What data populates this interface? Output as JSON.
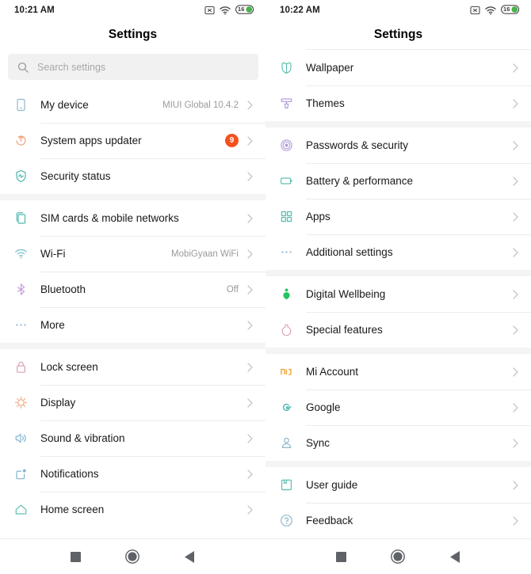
{
  "left": {
    "statusbar": {
      "clock": "10:21 AM",
      "battery_level": "16",
      "icons": [
        "no-sim-icon",
        "wifi-icon",
        "battery-icon"
      ]
    },
    "title": "Settings",
    "search": {
      "placeholder": "Search settings",
      "icon": "search-icon"
    },
    "groups": [
      {
        "rows": [
          {
            "icon": "phone-icon",
            "label": "My device",
            "value": "MIUI Global 10.4.2"
          },
          {
            "icon": "update-icon",
            "label": "System apps updater",
            "badge": "9"
          },
          {
            "icon": "shield-icon",
            "label": "Security status"
          }
        ]
      },
      {
        "rows": [
          {
            "icon": "sim-card-icon",
            "label": "SIM cards & mobile networks"
          },
          {
            "icon": "wifi-icon",
            "label": "Wi-Fi",
            "value": "MobiGyaan WiFi"
          },
          {
            "icon": "bluetooth-icon",
            "label": "Bluetooth",
            "value": "Off"
          },
          {
            "icon": "dots-icon",
            "label": "More"
          }
        ]
      },
      {
        "rows": [
          {
            "icon": "lock-icon",
            "label": "Lock screen"
          },
          {
            "icon": "brightness-icon",
            "label": "Display"
          },
          {
            "icon": "speaker-icon",
            "label": "Sound & vibration"
          },
          {
            "icon": "notification-icon",
            "label": "Notifications"
          },
          {
            "icon": "home-icon",
            "label": "Home screen"
          }
        ]
      }
    ]
  },
  "right": {
    "statusbar": {
      "clock": "10:22 AM",
      "battery_level": "16",
      "icons": [
        "no-sim-icon",
        "wifi-icon",
        "battery-icon"
      ]
    },
    "title": "Settings",
    "groups": [
      {
        "rows": [
          {
            "icon": "wallpaper-icon",
            "label": "Wallpaper"
          },
          {
            "icon": "themes-icon",
            "label": "Themes"
          }
        ]
      },
      {
        "rows": [
          {
            "icon": "fingerprint-icon",
            "label": "Passwords & security"
          },
          {
            "icon": "battery-icon",
            "label": "Battery & performance"
          },
          {
            "icon": "apps-grid-icon",
            "label": "Apps"
          },
          {
            "icon": "dots-icon",
            "label": "Additional settings"
          }
        ]
      },
      {
        "rows": [
          {
            "icon": "wellbeing-icon",
            "label": "Digital Wellbeing"
          },
          {
            "icon": "flask-icon",
            "label": "Special features"
          }
        ]
      },
      {
        "rows": [
          {
            "icon": "mi-icon",
            "label": "Mi Account"
          },
          {
            "icon": "google-icon",
            "label": "Google"
          },
          {
            "icon": "person-icon",
            "label": "Sync"
          }
        ]
      },
      {
        "rows": [
          {
            "icon": "book-icon",
            "label": "User guide"
          },
          {
            "icon": "question-icon",
            "label": "Feedback"
          }
        ]
      }
    ]
  },
  "navbar": {
    "buttons": [
      {
        "icon": "recents-square-icon",
        "label": "Recents"
      },
      {
        "icon": "home-circle-icon",
        "label": "Home"
      },
      {
        "icon": "back-triangle-icon",
        "label": "Back"
      }
    ]
  },
  "colors": {
    "badge": "#f4511e",
    "teal": "#4db6ac",
    "orange": "#f0a07a",
    "purple": "#b39ddb",
    "blue": "#8fb8cc",
    "pink": "#e0a6b8",
    "green": "#22c55e",
    "mi_orange": "#f0a33a",
    "divider": "#ececec",
    "group_gap": "#f4f4f4"
  }
}
